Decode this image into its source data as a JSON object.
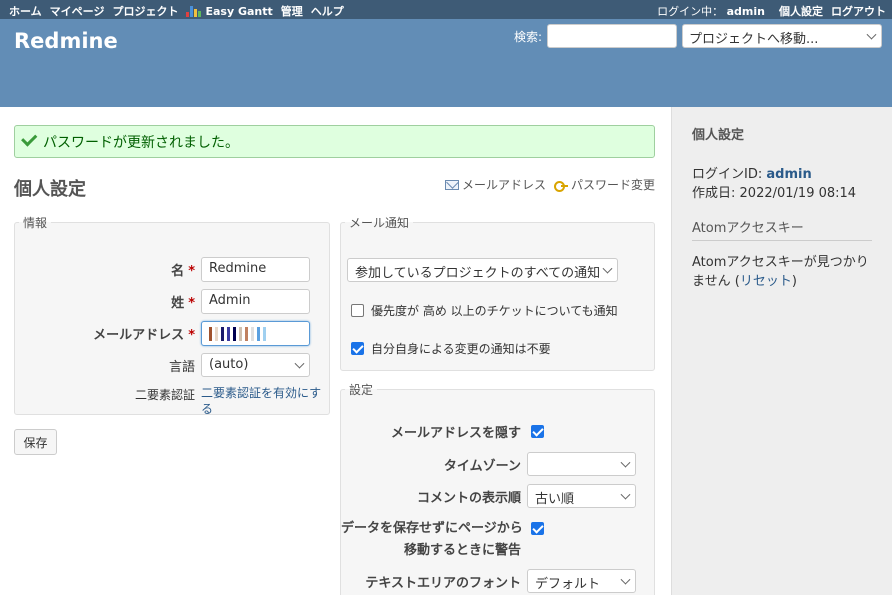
{
  "top_menu": {
    "items": [
      "ホーム",
      "マイページ",
      "プロジェクト"
    ],
    "gantt_label": "Easy Gantt",
    "items2": [
      "管理",
      "ヘルプ"
    ],
    "loggedas_prefix": "ログイン中：",
    "loggedas_user": "admin",
    "my_account": "個人設定",
    "logout": "ログアウト"
  },
  "header": {
    "title": "Redmine",
    "search_label": "検索:",
    "search_value": "",
    "jump_label": "プロジェクトへ移動..."
  },
  "flash": {
    "notice": "パスワードが更新されました。"
  },
  "page": {
    "title": "個人設定",
    "email_link": "メールアドレス",
    "password_link": "パスワード変更"
  },
  "info": {
    "legend": "情報",
    "firstname_label": "名",
    "firstname_value": "Redmine",
    "lastname_label": "姓",
    "lastname_value": "Admin",
    "mail_label": "メールアドレス",
    "required_mark": "*",
    "language_label": "言語",
    "language_value": "(auto)",
    "twofa_label": "二要素認証",
    "twofa_link": "二要素認証を有効にする"
  },
  "mail": {
    "legend": "メール通知",
    "notification_value": "参加しているプロジェクトのすべての通知",
    "high_priority_label": "優先度が 高め 以上のチケットについても通知",
    "no_self_notified_label": "自分自身による変更の通知は不要"
  },
  "pref": {
    "legend": "設定",
    "hide_mail_label": "メールアドレスを隠す",
    "timezone_label": "タイムゾーン",
    "timezone_value": "",
    "comments_order_label": "コメントの表示順",
    "comments_order_value": "古い順",
    "warn_label_1": "データを保存せずにページから",
    "warn_label_2": "移動するときに警告",
    "textarea_font_label": "テキストエリアのフォント",
    "textarea_font_value": "デフォルト"
  },
  "save_button": "保存",
  "sidebar": {
    "title": "個人設定",
    "login_label": "ログインID:",
    "login_value": "admin",
    "created_label": "作成日:",
    "created_value": "2022/01/19 08:14",
    "atom_heading": "Atomアクセスキー",
    "atom_text": "Atomアクセスキーが見つかりません",
    "reset_link": "リセット"
  },
  "colors": {
    "top_menu": "#3e5b76",
    "header": "#628db6",
    "flash_bg": "#dfffdf",
    "link": "#2a5a8a"
  }
}
